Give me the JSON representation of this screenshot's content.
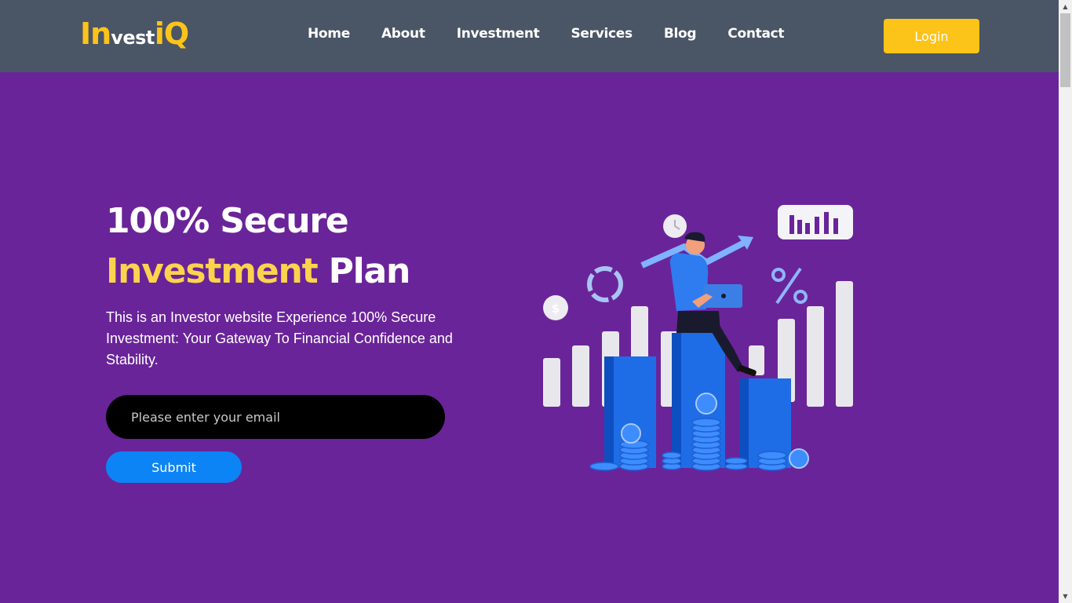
{
  "brand": {
    "logo_part1": "In",
    "logo_part2": "vest",
    "logo_part3": "iQ"
  },
  "nav": {
    "items": [
      {
        "label": "Home"
      },
      {
        "label": "About"
      },
      {
        "label": "Investment"
      },
      {
        "label": "Services"
      },
      {
        "label": "Blog"
      },
      {
        "label": "Contact"
      }
    ],
    "login_label": "Login"
  },
  "hero": {
    "title_line1": "100% Secure",
    "title_accent": "Investment",
    "title_rest": "Plan",
    "description": "This is an Investor website Experience 100% Secure Investment: Your Gateway To Financial Confidence and Stability.",
    "email_placeholder": "Please enter your email",
    "submit_label": "Submit"
  },
  "colors": {
    "brand_yellow": "#fcc419",
    "accent_text": "#fcd34d",
    "nav_bg": "#4a5565",
    "hero_bg": "#6a2499",
    "submit_blue": "#0d84f5"
  }
}
